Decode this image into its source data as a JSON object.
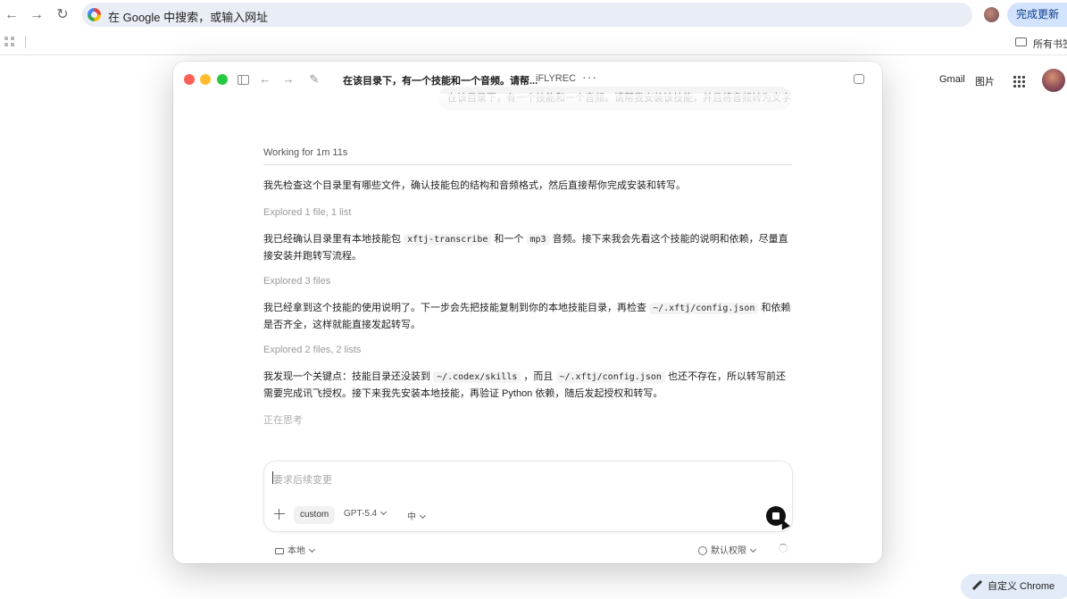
{
  "browser": {
    "omnibox_placeholder": "在 Google 中搜索，或输入网址",
    "update_button": "完成更新",
    "bookmarks_all": "所有书签"
  },
  "google_page": {
    "gmail": "Gmail",
    "images": "图片",
    "customize_button": "自定义 Chrome"
  },
  "window": {
    "title": "在该目录下，有一个技能和一个音频。请帮...",
    "project": "iFLYREC",
    "more": "···"
  },
  "conversation": {
    "user_message": "在该目录下，有一个技能和一个音频。请帮我安装该技能，并且将音频转为文字。",
    "working_label": "Working for 1m 11s",
    "items": [
      {
        "type": "text",
        "segments": [
          "我先检查这个目录里有哪些文件，确认技能包的结构和音频格式，然后直接帮你完成安装和转写。"
        ]
      },
      {
        "type": "meta",
        "text": "Explored 1 file, 1 list"
      },
      {
        "type": "text",
        "segments": [
          "我已经确认目录里有本地技能包 ",
          "xftj-transcribe",
          " 和一个 ",
          "mp3",
          " 音频。接下来我会先看这个技能的说明和依赖，尽量直接安装并跑转写流程。"
        ]
      },
      {
        "type": "meta",
        "text": "Explored 3 files"
      },
      {
        "type": "text",
        "segments": [
          "我已经拿到这个技能的使用说明了。下一步会先把技能复制到你的本地技能目录，再检查 ",
          "~/.xftj/config.json",
          " 和依赖是否齐全，这样就能直接发起转写。"
        ]
      },
      {
        "type": "meta",
        "text": "Explored 2 files, 2 lists"
      },
      {
        "type": "text",
        "segments": [
          "我发现一个关键点：技能目录还没装到 ",
          "~/.codex/skills",
          " ，而且 ",
          "~/.xftj/config.json",
          " 也还不存在，所以转写前还需要完成讯飞授权。接下来我先安装本地技能，再验证 Python 依赖，随后发起授权和转写。"
        ]
      }
    ],
    "thinking": "正在思考"
  },
  "composer": {
    "placeholder": "要求后续变更",
    "chip": "custom",
    "model": "GPT-5.4",
    "effort": "中"
  },
  "footer": {
    "location": "本地",
    "permissions": "默认权限"
  },
  "icons": [
    "back-icon",
    "forward-icon",
    "reload-icon",
    "google-logo-icon",
    "apps-grid-icon",
    "folder-icon",
    "sidebar-toggle-icon",
    "compose-icon",
    "panel-icon",
    "plus-icon",
    "stop-icon",
    "spinner-icon",
    "pencil-icon"
  ]
}
